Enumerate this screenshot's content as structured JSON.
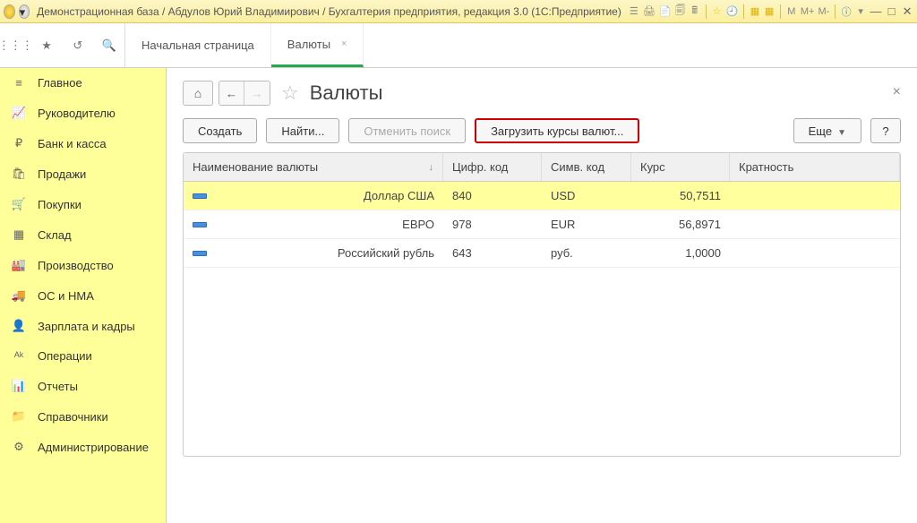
{
  "titlebar": {
    "text": "Демонстрационная база / Абдулов Юрий Владимирович / Бухгалтерия предприятия, редакция 3.0  (1С:Предприятие)"
  },
  "tabs": {
    "home": "Начальная страница",
    "currencies": "Валюты"
  },
  "sidebar": {
    "items": [
      {
        "icon": "≡",
        "label": "Главное"
      },
      {
        "icon": "📈",
        "label": "Руководителю"
      },
      {
        "icon": "₽",
        "label": "Банк и касса"
      },
      {
        "icon": "🛍",
        "label": "Продажи"
      },
      {
        "icon": "🛒",
        "label": "Покупки"
      },
      {
        "icon": "▦",
        "label": "Склад"
      },
      {
        "icon": "🏭",
        "label": "Производство"
      },
      {
        "icon": "🚚",
        "label": "ОС и НМА"
      },
      {
        "icon": "👤",
        "label": "Зарплата и кадры"
      },
      {
        "icon": "ᴬᵏ",
        "label": "Операции"
      },
      {
        "icon": "📊",
        "label": "Отчеты"
      },
      {
        "icon": "📁",
        "label": "Справочники"
      },
      {
        "icon": "⚙",
        "label": "Администрирование"
      }
    ]
  },
  "page": {
    "title": "Валюты",
    "toolbar": {
      "create": "Создать",
      "find": "Найти...",
      "cancel_search": "Отменить поиск",
      "load_rates": "Загрузить курсы валют...",
      "more": "Еще",
      "help": "?"
    },
    "columns": {
      "name": "Наименование валюты",
      "num_code": "Цифр. код",
      "sym_code": "Симв. код",
      "rate": "Курс",
      "mult": "Кратность"
    },
    "rows": [
      {
        "name": "Доллар США",
        "num": "840",
        "sym": "USD",
        "rate": "50,7511",
        "selected": true
      },
      {
        "name": "ЕВРО",
        "num": "978",
        "sym": "EUR",
        "rate": "56,8971",
        "selected": false
      },
      {
        "name": "Российский рубль",
        "num": "643",
        "sym": "руб.",
        "rate": "1,0000",
        "selected": false
      }
    ]
  }
}
